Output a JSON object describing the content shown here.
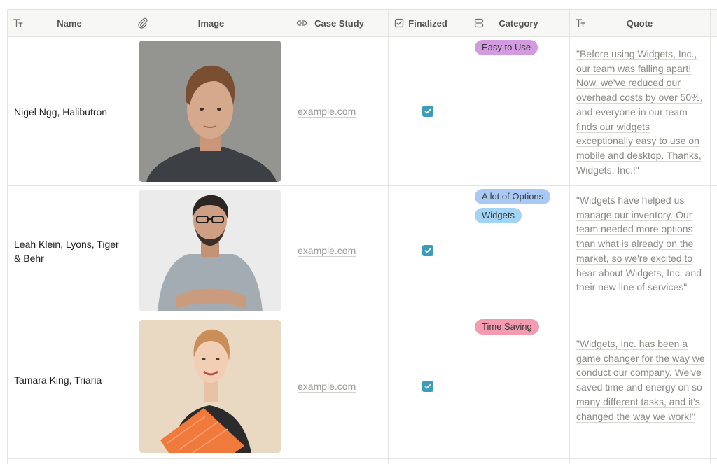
{
  "table": {
    "columns": [
      {
        "label": "Name",
        "icon": "text-type-icon"
      },
      {
        "label": "Image",
        "icon": "paperclip-icon"
      },
      {
        "label": "Case Study",
        "icon": "link-icon"
      },
      {
        "label": "Finalized",
        "icon": "checkbox-icon"
      },
      {
        "label": "Category",
        "icon": "multi-select-icon"
      },
      {
        "label": "Quote",
        "icon": "text-type-icon"
      }
    ],
    "rows": [
      {
        "name": "Nigel Ngg, Halibutron",
        "case_study": "example.com",
        "finalized": true,
        "categories": [
          {
            "label": "Easy to Use",
            "color": "#d39ce0"
          }
        ],
        "quote": "\"Before using Widgets, Inc., our team was falling apart! Now, we've reduced our overhead costs by over 50%, and everyone in our team finds our widgets exceptionally easy to use on mobile and desktop. Thanks, Widgets, Inc.!\""
      },
      {
        "name": "Leah Klein, Lyons, Tiger & Behr",
        "case_study": "example.com",
        "finalized": true,
        "categories": [
          {
            "label": "A lot of Options",
            "color": "#a9c9f4"
          },
          {
            "label": "Widgets",
            "color": "#a3d4f5"
          }
        ],
        "quote": "\"Widgets have helped us manage our inventory. Our team needed more options than what is already on the market, so we're excited to hear about Widgets, Inc. and their new line of services\""
      },
      {
        "name": "Tamara King, Triaria",
        "case_study": "example.com",
        "finalized": true,
        "categories": [
          {
            "label": "Time Saving",
            "color": "#f29bb1"
          }
        ],
        "quote": "\"Widgets, Inc. has been a game changer for the way we conduct our company. We've saved time and energy on so many different tasks, and it's changed the way we work!\""
      }
    ]
  }
}
